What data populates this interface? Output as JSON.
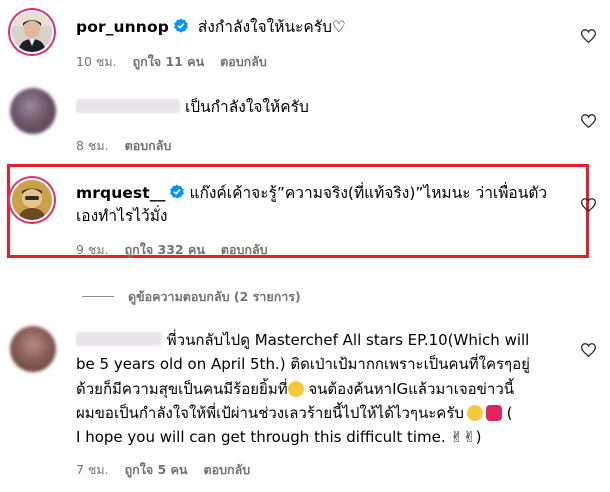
{
  "comments": [
    {
      "username": "por_unnop",
      "text": "ส่งกำลังใจให้นะครับ♡",
      "time": "10 ชม.",
      "likes": "ถูกใจ 11 คน",
      "reply": "ตอบกลับ"
    },
    {
      "username": "",
      "text": "เป็นกำลังใจให้ครับ",
      "time": "8 ชม.",
      "reply": "ตอบกลับ"
    },
    {
      "username": "mrquest__",
      "text_line1": "แก๊งค์เค้าจะรู้”ความจริง(ที่แท้จริง)”ไหมนะ ว่าเพื่อนตัว",
      "text_line2": "เองทำไรไว้มั่ง",
      "time": "9 ชม.",
      "likes": "ถูกใจ 332 คน",
      "reply": "ตอบกลับ"
    },
    {
      "username": "",
      "line1": "พี่วนกลับไปดู Masterchef All stars EP.10(Which will",
      "line2": "be 5 years old on April 5th.) ติดเป่าเป้มากกเพราะเป็นคนที่ใครๆอยู่",
      "line3": "ด้วยก็มีความสุขเป็นคนมีร้อยยิ้มที่",
      "line3b": " จนต้องค้นหาIGแล้วมาเจอข่าวนี้",
      "line4": "ผมขอเป็นกำลังใจให้พี่เป้ผ่านช่วงเลวร้ายนี้ไปให้ได้ไวๆนะครับ",
      "line4b": " (",
      "line5": "I hope you will can get through this difficult time. ",
      "time": "7 ชม.",
      "likes": "ถูกใจ 5 คน",
      "reply": "ตอบกลับ"
    }
  ],
  "view_replies": "ดูข้อความตอบกลับ (2 รายการ)",
  "colors": {
    "verified": "#0095f6",
    "highlight": "#e81e2c",
    "meta": "#737373"
  }
}
